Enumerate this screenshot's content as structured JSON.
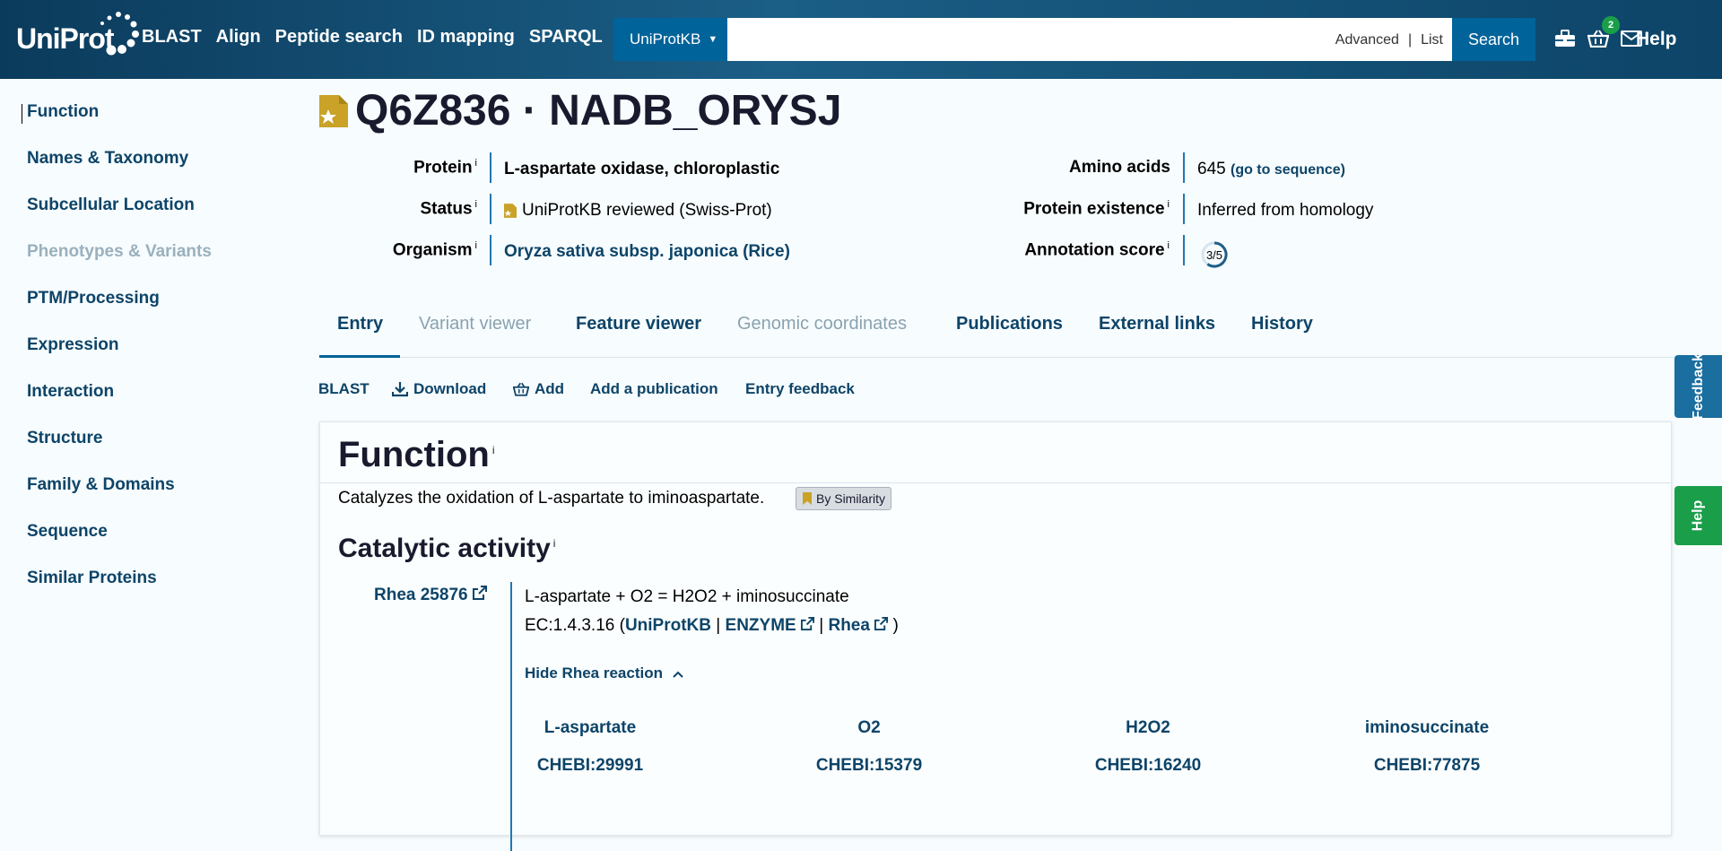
{
  "header": {
    "logo_text": "UniProt",
    "nav": [
      "BLAST",
      "Align",
      "Peptide search",
      "ID mapping",
      "SPARQL"
    ],
    "db_select": "UniProtKB",
    "search_placeholder": "",
    "advanced": "Advanced",
    "list": "List",
    "search_button": "Search",
    "basket_count": "2",
    "help": "Help"
  },
  "sidebar": {
    "items": [
      "Function",
      "Names & Taxonomy",
      "Subcellular Location",
      "Phenotypes & Variants",
      "PTM/Processing",
      "Expression",
      "Interaction",
      "Structure",
      "Family & Domains",
      "Sequence",
      "Similar Proteins"
    ],
    "disabled": [
      "Phenotypes & Variants"
    ],
    "active": "Function"
  },
  "entry": {
    "title": "Q6Z836 · NADB_ORYSJ",
    "protein_label": "Protein",
    "protein_value": "L-aspartate oxidase, chloroplastic",
    "status_label": "Status",
    "status_value": "UniProtKB reviewed (Swiss-Prot)",
    "organism_label": "Organism",
    "organism_value": "Oryza sativa subsp. japonica (Rice)",
    "amino_acids_label": "Amino acids",
    "amino_acids_value": "645",
    "go_to_sequence": "(go to sequence)",
    "existence_label": "Protein existence",
    "existence_value": "Inferred from homology",
    "score_label": "Annotation score",
    "score_value": "3/5",
    "info_mark": "i"
  },
  "tabs": [
    "Entry",
    "Variant viewer",
    "Feature viewer",
    "Genomic coordinates",
    "Publications",
    "External links",
    "History"
  ],
  "actions": [
    "BLAST",
    "Download",
    "Add",
    "Add a publication",
    "Entry feedback"
  ],
  "function": {
    "heading": "Function",
    "text": "Catalyzes the oxidation of L-aspartate to iminoaspartate.",
    "evidence": "By Similarity",
    "catalytic_heading": "Catalytic activity",
    "rhea_id": "Rhea 25876",
    "reaction": "L-aspartate + O2 = H2O2 + iminosuccinate",
    "ec_prefix": "EC:1.4.3.16 (",
    "ec_uniprot": "UniProtKB",
    "ec_sep1": " | ",
    "ec_enzyme": "ENZYME",
    "ec_sep2": " | ",
    "ec_rhea": "Rhea",
    "ec_suffix": " )",
    "hide_rhea": "Hide Rhea reaction",
    "compounds": [
      {
        "name": "L-aspartate",
        "chebi": "CHEBI:29991"
      },
      {
        "name": "O2",
        "chebi": "CHEBI:15379"
      },
      {
        "name": "H2O2",
        "chebi": "CHEBI:16240"
      },
      {
        "name": "iminosuccinate",
        "chebi": "CHEBI:77875"
      }
    ]
  },
  "side_tabs": {
    "feedback": "Feedback",
    "help": "Help"
  },
  "colors": {
    "header_dark": "#0b3b5c",
    "primary": "#00639a",
    "link": "#0d4468",
    "help_green": "#1a9e4a",
    "reviewed_gold": "#c9a227"
  }
}
